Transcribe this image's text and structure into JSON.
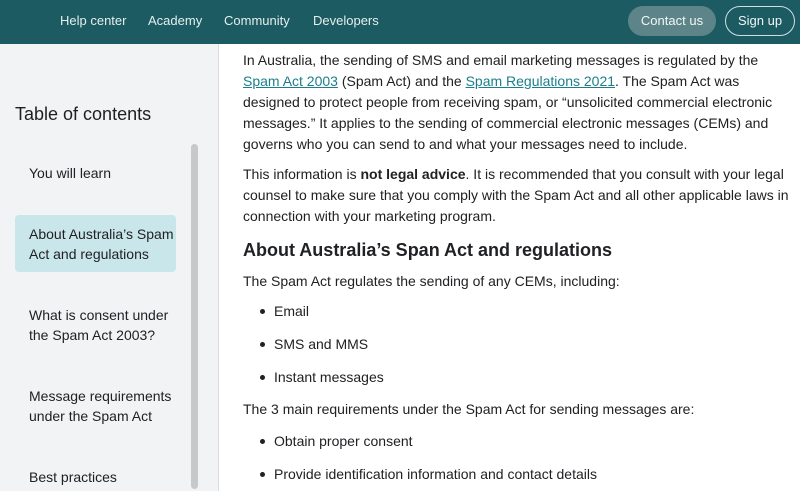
{
  "nav": {
    "links": [
      "Help center",
      "Academy",
      "Community",
      "Developers"
    ],
    "contact_label": "Contact us",
    "signup_label": "Sign up"
  },
  "toc": {
    "title": "Table of contents",
    "items": [
      "You will learn",
      "About Australia’s Spam Act and regulations",
      "What is consent under the Spam Act 2003?",
      "Message requirements under the Spam Act",
      "Best practices"
    ],
    "active_index": 1
  },
  "content": {
    "p1_a": "In Australia, the sending of SMS and email marketing messages is regulated by the ",
    "p1_link1": "Spam Act 2003",
    "p1_b": " (Spam Act) and the ",
    "p1_link2": "Spam Regulations 2021",
    "p1_c": ". The Spam Act was designed to protect people from receiving spam, or “unsolicited commercial electronic messages.” It applies to the sending of commercial electronic messages (CEMs) and governs who you can send to and what your messages need to include.",
    "p2_a": "This information is ",
    "p2_bold": "not legal advice",
    "p2_b": ". It is recommended that you consult with your legal counsel to make sure that you comply with the Spam Act and all other applicable laws in connection with your marketing program.",
    "heading": "About Australia’s Span Act and regulations",
    "p3": "The Spam Act regulates the sending of any CEMs, including:",
    "list1": [
      "Email",
      "SMS and MMS",
      "Instant messages"
    ],
    "p4": "The 3 main requirements under the Spam Act for sending messages are:",
    "list2": [
      "Obtain proper consent",
      "Provide identification information and contact details"
    ]
  },
  "colors": {
    "nav_bg": "#1d5b62",
    "link": "#1a7f8a",
    "toc_active_bg": "#c9e7ea"
  }
}
